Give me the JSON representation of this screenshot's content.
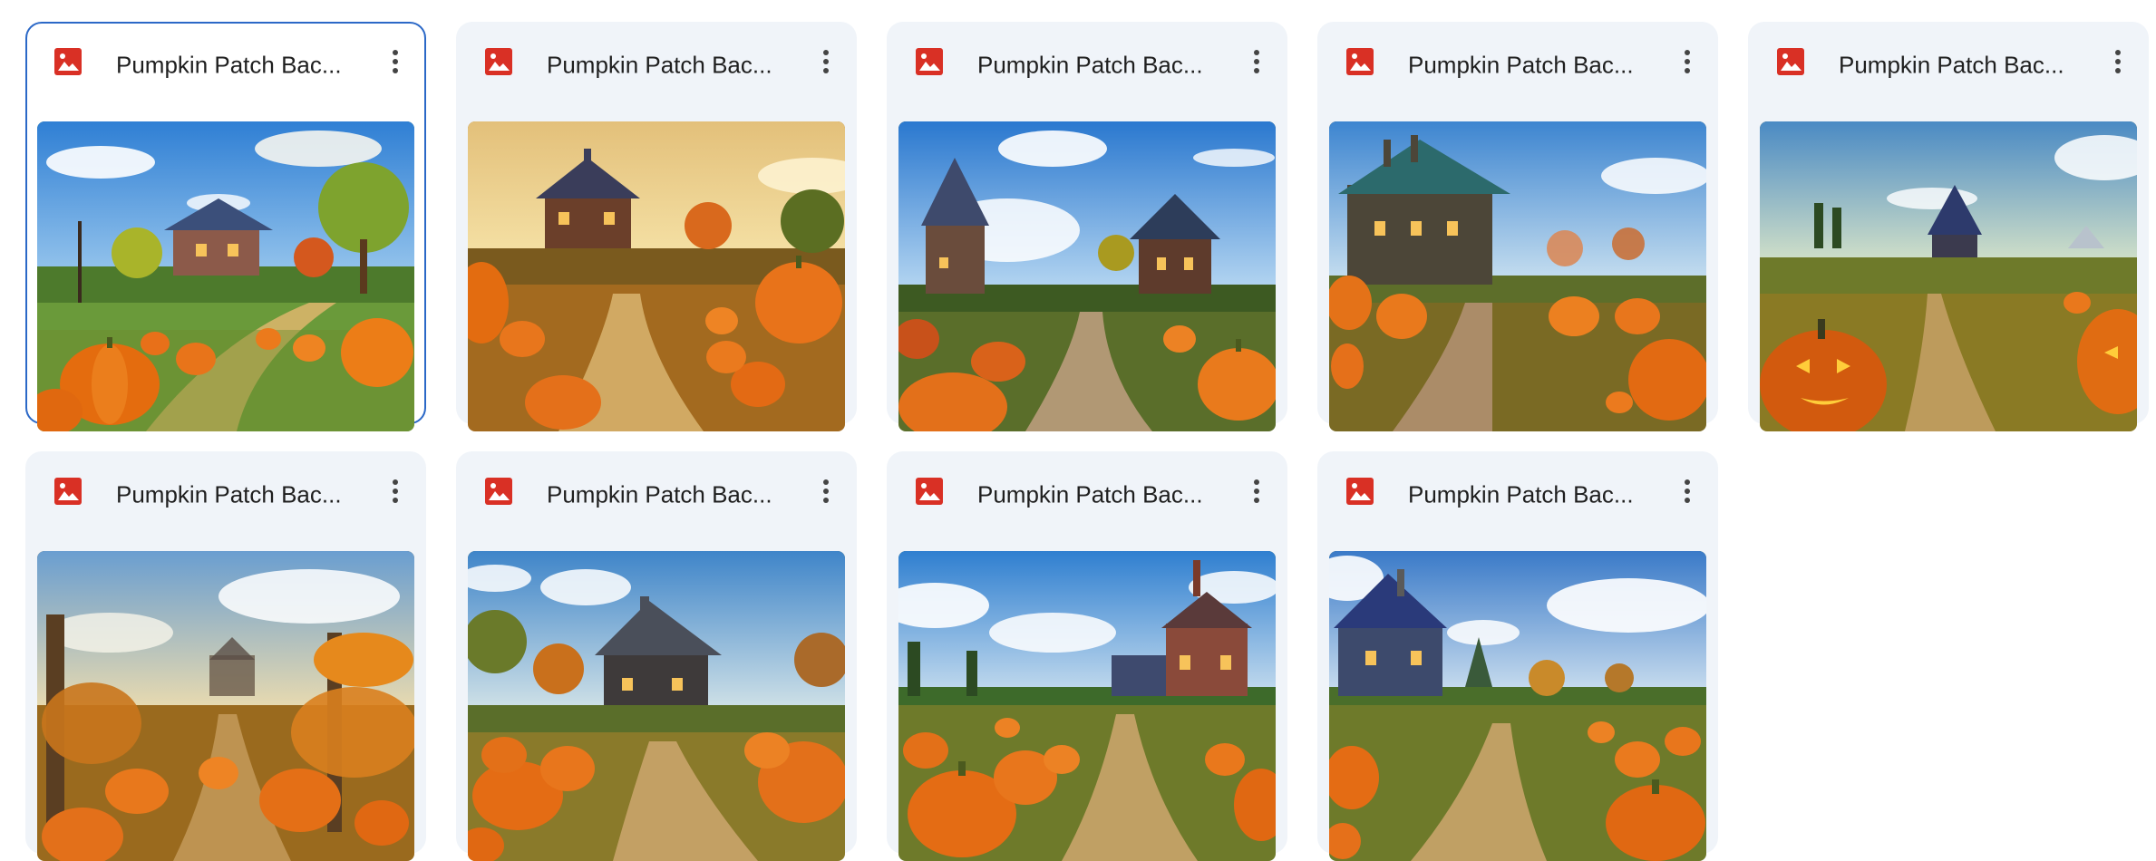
{
  "files": [
    {
      "name": "Pumpkin Patch Bac...",
      "selected": true
    },
    {
      "name": "Pumpkin Patch Bac...",
      "selected": false
    },
    {
      "name": "Pumpkin Patch Bac...",
      "selected": false
    },
    {
      "name": "Pumpkin Patch Bac...",
      "selected": false
    },
    {
      "name": "Pumpkin Patch Bac...",
      "selected": false
    },
    {
      "name": "Pumpkin Patch Bac...",
      "selected": false
    },
    {
      "name": "Pumpkin Patch Bac...",
      "selected": false
    },
    {
      "name": "Pumpkin Patch Bac...",
      "selected": false
    },
    {
      "name": "Pumpkin Patch Bac...",
      "selected": false
    }
  ],
  "icons": {
    "file_type": "image-file-icon",
    "menu": "more-vert-icon"
  },
  "colors": {
    "file_icon": "#d93025",
    "selection": "#2b68c7",
    "card_bg": "#f0f4f9"
  }
}
